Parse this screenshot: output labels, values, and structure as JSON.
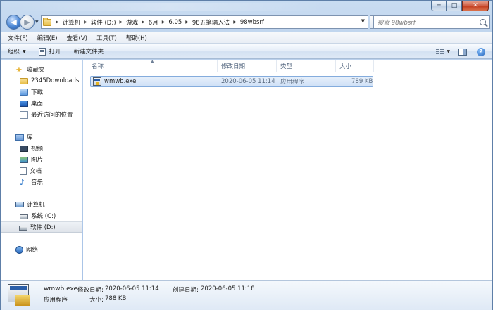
{
  "window": {
    "controls": {
      "minimize": "─",
      "maximize": "□",
      "close": "✕"
    }
  },
  "address": {
    "crumbs": [
      "计算机",
      "软件 (D:)",
      "游戏",
      "6月",
      "6.05",
      "98五笔输入法",
      "98wbsrf"
    ],
    "search_placeholder": "搜索 98wbsrf",
    "refresh_glyph": "↻",
    "back_glyph": "◀",
    "forward_glyph": "▶"
  },
  "menu": [
    "文件(F)",
    "编辑(E)",
    "查看(V)",
    "工具(T)",
    "帮助(H)"
  ],
  "toolbar": {
    "organize": "组织",
    "open": "打开",
    "new_folder": "新建文件夹",
    "help_glyph": "?"
  },
  "nav": {
    "favorites": {
      "label": "收藏夹",
      "items": [
        "2345Downloads",
        "下载",
        "桌面",
        "最近访问的位置"
      ]
    },
    "libraries": {
      "label": "库",
      "items": [
        "视频",
        "图片",
        "文档",
        "音乐"
      ]
    },
    "computer": {
      "label": "计算机",
      "items": [
        "系统 (C:)",
        "软件 (D:)"
      ],
      "selected": "软件 (D:)"
    },
    "network": {
      "label": "网络"
    }
  },
  "columns": {
    "name": "名称",
    "modified": "修改日期",
    "type": "类型",
    "size": "大小"
  },
  "files": [
    {
      "name": "wmwb.exe",
      "modified": "2020-06-05 11:14",
      "type": "应用程序",
      "size": "789 KB"
    }
  ],
  "details": {
    "filename": "wmwb.exe",
    "modified_label": "修改日期:",
    "modified_value": "2020-06-05 11:14",
    "created_label": "创建日期:",
    "created_value": "2020-06-05 11:18",
    "type": "应用程序",
    "size_label": "大小:",
    "size_value": "788 KB"
  }
}
